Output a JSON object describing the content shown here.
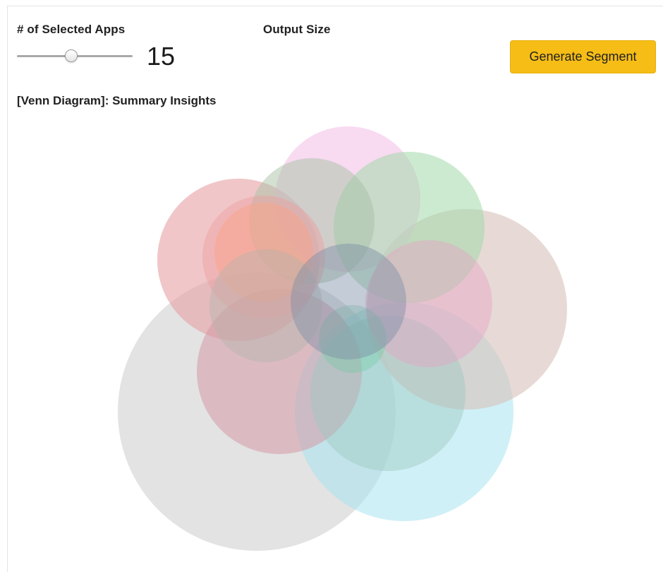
{
  "controls": {
    "apps_label": "# of Selected Apps",
    "output_label": "Output Size",
    "slider_value": "15",
    "slider_fraction": 0.47,
    "generate_label": "Generate Segment"
  },
  "venn": {
    "title": "[Venn Diagram]: Summary Insights",
    "set_colors": [
      "#d8d8d8",
      "#a8e4ef",
      "#d7c1bb",
      "#e6a0a4",
      "#d69aa6",
      "#f3bce6",
      "#a2d9a9",
      "#a8c2a6",
      "#ee9e9e",
      "#ffa083",
      "#b2b3ac",
      "#9ec8c2",
      "#e6a4c6",
      "#6ccba0",
      "#7d8fa6"
    ]
  },
  "colors": {
    "accent": "#f6bd16",
    "panel_border": "#e3e3e3"
  }
}
